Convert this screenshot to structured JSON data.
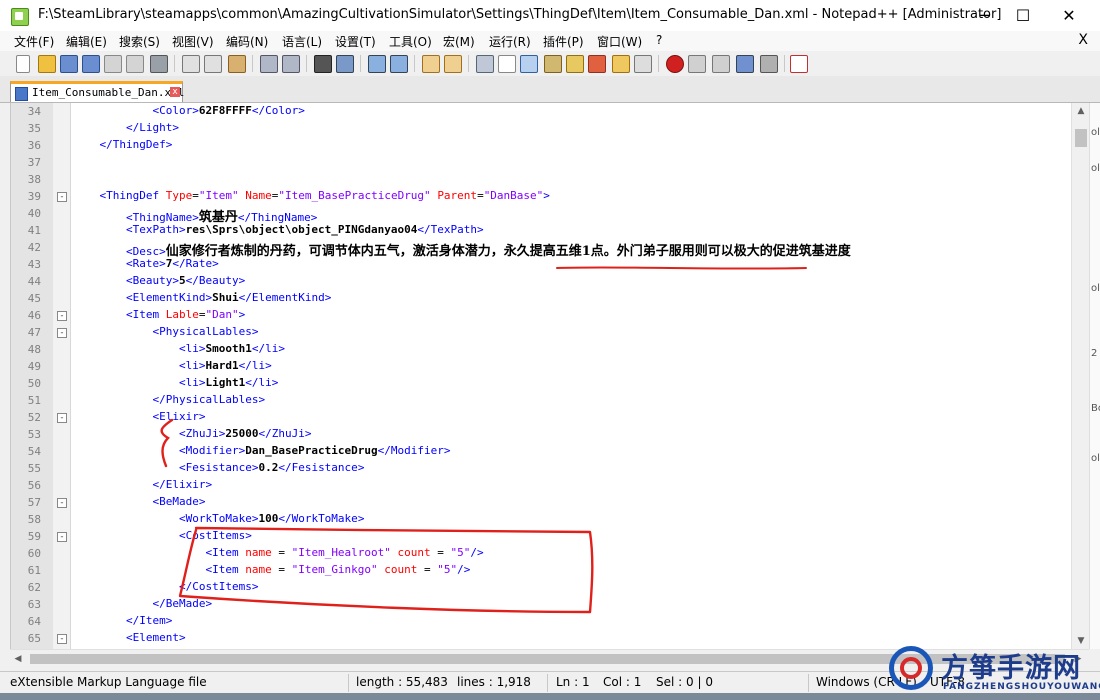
{
  "window": {
    "title": "F:\\SteamLibrary\\steamapps\\common\\AmazingCultivationSimulator\\Settings\\ThingDef\\Item\\Item_Consumable_Dan.xml - Notepad++ [Administrator]",
    "minimize": "─",
    "maximize": "☐",
    "close": "✕"
  },
  "menu": {
    "items": [
      "文件(F)",
      "编辑(E)",
      "搜索(S)",
      "视图(V)",
      "编码(N)",
      "语言(L)",
      "设置(T)",
      "工具(O)",
      "宏(M)",
      "运行(R)",
      "插件(P)",
      "窗口(W)",
      "?"
    ],
    "close_doc": "X"
  },
  "tab": {
    "label": "Item_Consumable_Dan.xml",
    "close": "x"
  },
  "editor": {
    "lines": [
      {
        "n": "34",
        "fold": "",
        "code": "            <Color>62F8FFFF</Color>"
      },
      {
        "n": "35",
        "fold": "",
        "code": "        </Light>"
      },
      {
        "n": "36",
        "fold": "",
        "code": "    </ThingDef>"
      },
      {
        "n": "37",
        "fold": "",
        "code": ""
      },
      {
        "n": "38",
        "fold": "",
        "code": ""
      },
      {
        "n": "39",
        "fold": "-",
        "code": "    <ThingDef Type=\"Item\" Name=\"Item_BasePracticeDrug\" Parent=\"DanBase\">"
      },
      {
        "n": "40",
        "fold": "",
        "code": "        <ThingName>筑基丹</ThingName>"
      },
      {
        "n": "41",
        "fold": "",
        "code": "        <TexPath>res\\Sprs\\object\\object_PINGdanyao04</TexPath>"
      },
      {
        "n": "42",
        "fold": "",
        "code": "        <Desc>仙家修行者炼制的丹药，可调节体内五气，激活身体潜力，永久提高五维1点。外门弟子服用则可以极大的促进筑基进度"
      },
      {
        "n": "43",
        "fold": "",
        "code": "        <Rate>7</Rate>"
      },
      {
        "n": "44",
        "fold": "",
        "code": "        <Beauty>5</Beauty>"
      },
      {
        "n": "45",
        "fold": "",
        "code": "        <ElementKind>Shui</ElementKind>"
      },
      {
        "n": "46",
        "fold": "-",
        "code": "        <Item Lable=\"Dan\">"
      },
      {
        "n": "47",
        "fold": "-",
        "code": "            <PhysicalLables>"
      },
      {
        "n": "48",
        "fold": "",
        "code": "                <li>Smooth1</li>"
      },
      {
        "n": "49",
        "fold": "",
        "code": "                <li>Hard1</li>"
      },
      {
        "n": "50",
        "fold": "",
        "code": "                <li>Light1</li>"
      },
      {
        "n": "51",
        "fold": "",
        "code": "            </PhysicalLables>"
      },
      {
        "n": "52",
        "fold": "-",
        "code": "            <Elixir>"
      },
      {
        "n": "53",
        "fold": "",
        "code": "                <ZhuJi>25000</ZhuJi>"
      },
      {
        "n": "54",
        "fold": "",
        "code": "                <Modifier>Dan_BasePracticeDrug</Modifier>"
      },
      {
        "n": "55",
        "fold": "",
        "code": "                <Fesistance>0.2</Fesistance>"
      },
      {
        "n": "56",
        "fold": "",
        "code": "            </Elixir>"
      },
      {
        "n": "57",
        "fold": "-",
        "code": "            <BeMade>"
      },
      {
        "n": "58",
        "fold": "",
        "code": "                <WorkToMake>100</WorkToMake>"
      },
      {
        "n": "59",
        "fold": "-",
        "code": "                <CostItems>"
      },
      {
        "n": "60",
        "fold": "",
        "code": "                    <Item name = \"Item_Healroot\" count = \"5\"/>"
      },
      {
        "n": "61",
        "fold": "",
        "code": "                    <Item name = \"Item_Ginkgo\" count = \"5\"/>"
      },
      {
        "n": "62",
        "fold": "",
        "code": "                </CostItems>"
      },
      {
        "n": "63",
        "fold": "",
        "code": "            </BeMade>"
      },
      {
        "n": "64",
        "fold": "",
        "code": "        </Item>"
      },
      {
        "n": "65",
        "fold": "-",
        "code": "        <Element>"
      }
    ]
  },
  "right_strip": [
    "ol",
    "ol",
    "ol",
    "2",
    "Bo",
    "ol"
  ],
  "status": {
    "file_type": "eXtensible Markup Language file",
    "length": "length : 55,483",
    "lines": "lines : 1,918",
    "ln": "Ln : 1",
    "col": "Col : 1",
    "sel": "Sel : 0 | 0",
    "eol": "Windows (CR LF)",
    "encoding": "UTF-8"
  },
  "watermark": {
    "text": "方箏手游网",
    "sub": "FANGZHENGSHOUYOUWANG"
  },
  "colors": {
    "tag": "#0000ff",
    "attr": "#ff0000",
    "value": "#8000ff",
    "annotation": "#e0201a",
    "tab_accent": "#f7a723"
  }
}
